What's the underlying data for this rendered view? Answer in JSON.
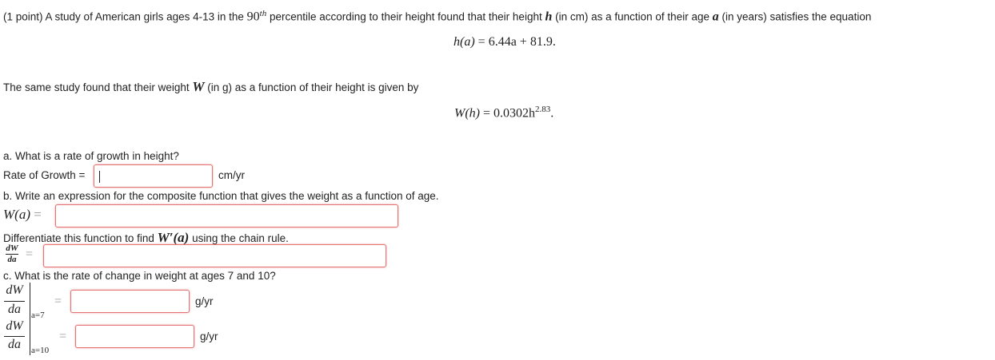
{
  "intro": {
    "prefix": "(1 point) A study of American girls ages 4-13 in the ",
    "percentile_base": "90",
    "percentile_sup": "th",
    "middle": " percentile according to their height found that their height ",
    "var_h": "h",
    "units_h": " (in cm) as a function of their age ",
    "var_a": "a",
    "suffix": " (in years) satisfies the equation"
  },
  "eq_height": {
    "lhs": "h(a)",
    "equals": "=",
    "rhs": "6.44a + 81.9."
  },
  "weight_sentence": {
    "prefix": "The same study found that their weight ",
    "var_W": "W",
    "suffix": " (in g) as a function of their height is given by"
  },
  "eq_weight": {
    "lhs": "W(h)",
    "equals": "=",
    "coef": "0.0302h",
    "exponent": "2.83",
    "end": "."
  },
  "part_a": {
    "question": "a. What is a rate of growth in height?",
    "label": "Rate of Growth =",
    "input_value": "",
    "units": "cm/yr"
  },
  "part_b": {
    "question": "b. Write an expression for the composite function that gives the weight as a function of age.",
    "lhs": "W(a)",
    "equals": "=",
    "input_value": "",
    "diff_prefix": "Differentiate this function to find ",
    "diff_func": "W′(a)",
    "diff_suffix": " using the chain rule.",
    "dW_num": "dW",
    "dW_den": "da",
    "dW_equals": "=",
    "deriv_input_value": ""
  },
  "part_c": {
    "question": "c. What is the rate of change in weight at ages 7 and 10?",
    "rows": [
      {
        "num": "dW",
        "den": "da",
        "eval": "a=7",
        "equals": "=",
        "input_value": "",
        "units": "g/yr"
      },
      {
        "num": "dW",
        "den": "da",
        "eval": "a=10",
        "equals": "=",
        "input_value": "",
        "units": "g/yr"
      }
    ]
  },
  "colors": {
    "text": "#222222",
    "input_border": "#e57373",
    "equals_gray": "#999999"
  }
}
